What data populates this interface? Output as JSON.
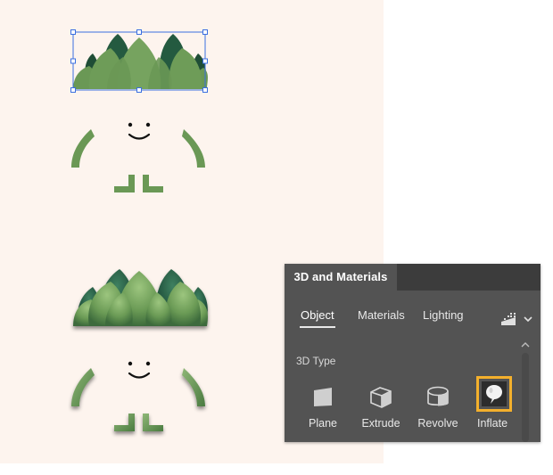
{
  "panel": {
    "title": "3D and Materials",
    "tabs": [
      {
        "label": "Object",
        "active": true
      },
      {
        "label": "Materials",
        "active": false
      },
      {
        "label": "Lighting",
        "active": false
      }
    ],
    "section_label": "3D Type",
    "types": [
      {
        "label": "Plane",
        "icon": "plane-icon"
      },
      {
        "label": "Extrude",
        "icon": "extrude-icon"
      },
      {
        "label": "Revolve",
        "icon": "revolve-icon"
      },
      {
        "label": "Inflate",
        "icon": "inflate-icon",
        "selected": true
      }
    ],
    "selected_color": "#f4b02c"
  },
  "colors": {
    "canvas_bg": "#fdf4ee",
    "leaf_green": "#6f9a58",
    "leaf_dark": "#2e5b44",
    "selection_blue": "#3b6fe0"
  }
}
